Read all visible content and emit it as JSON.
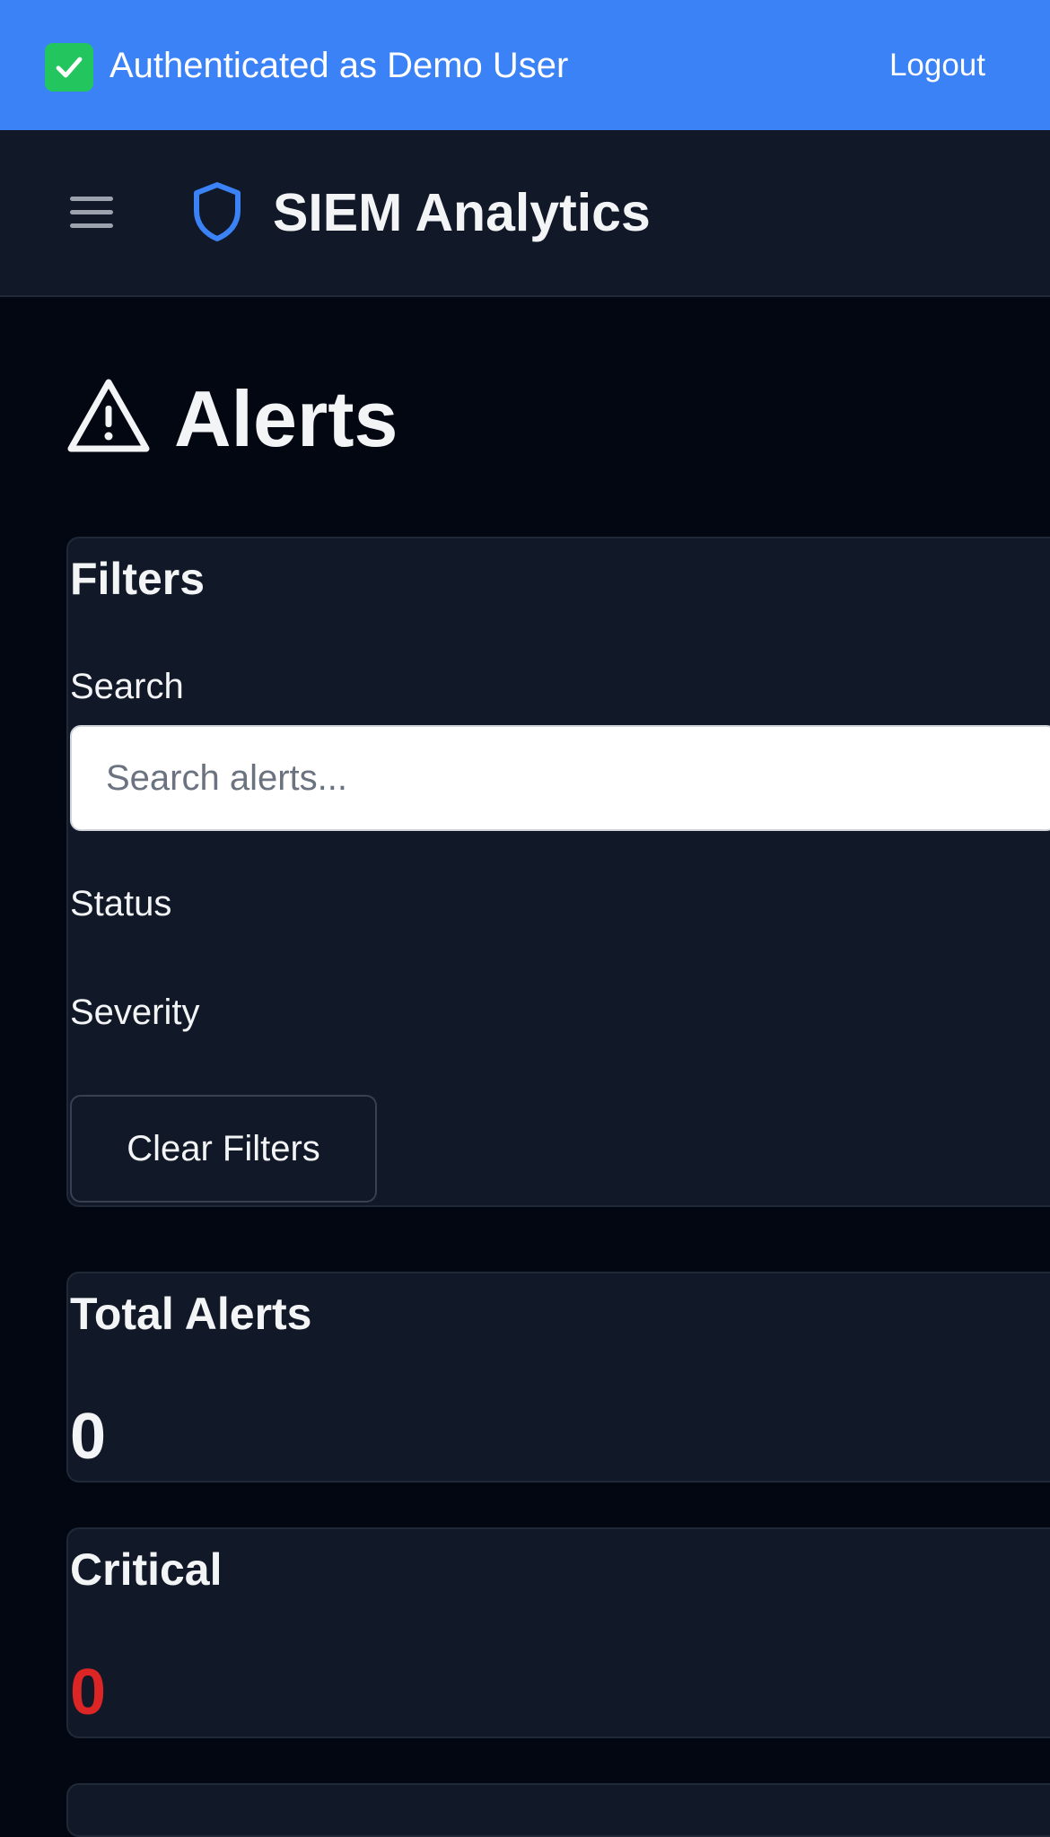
{
  "auth_banner": {
    "text": "Authenticated as Demo User",
    "logout_label": "Logout",
    "icon": "check-mark-icon"
  },
  "topnav": {
    "menu_icon": "hamburger-menu-icon",
    "brand_icon": "shield-icon",
    "brand_name": "SIEM Analytics"
  },
  "page": {
    "title": "Alerts",
    "title_icon": "warning-triangle-icon"
  },
  "filters": {
    "title": "Filters",
    "search_label": "Search",
    "search_placeholder": "Search alerts...",
    "search_value": "",
    "status_label": "Status",
    "severity_label": "Severity",
    "clear_label": "Clear Filters"
  },
  "stats": {
    "total": {
      "label": "Total Alerts",
      "value": "0"
    },
    "critical": {
      "label": "Critical",
      "value": "0"
    }
  },
  "colors": {
    "banner": "#3b82f6",
    "nav_bg": "#111827",
    "page_bg": "#030712",
    "card_bg": "#111827",
    "critical": "#dc2626",
    "brand_shield": "#3b82f6"
  }
}
